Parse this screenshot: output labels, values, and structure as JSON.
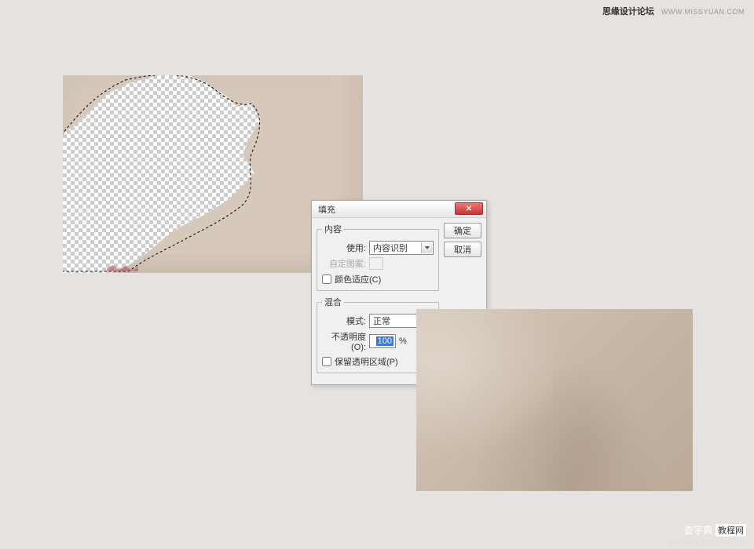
{
  "watermark_top": {
    "site": "思缘设计论坛",
    "url": "WWW.MISSYUAN.COM"
  },
  "watermark_bottom": {
    "brand": "查字典",
    "tag": "教程网",
    "url": "jiaocheng.chazidian.com"
  },
  "dialog": {
    "title": "填充",
    "ok_label": "确定",
    "cancel_label": "取消",
    "content_group": {
      "legend": "内容",
      "use_label": "使用:",
      "use_value": "内容识别",
      "pattern_label": "自定图案:",
      "color_adapt_label": "颜色适应(C)"
    },
    "blend_group": {
      "legend": "混合",
      "mode_label": "模式:",
      "mode_value": "正常",
      "opacity_label": "不透明度(O):",
      "opacity_value": "100",
      "opacity_unit": "%",
      "preserve_label": "保留透明区域(P)"
    }
  }
}
